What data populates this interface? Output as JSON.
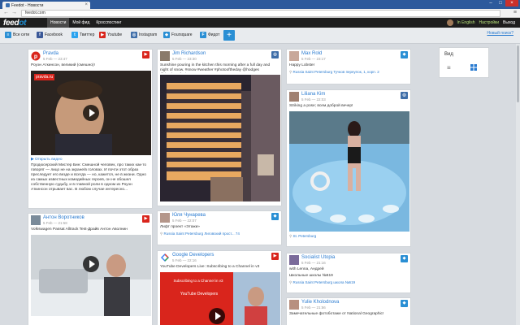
{
  "browser": {
    "tab_title": "Feedot - Новости",
    "url": "feedot.com",
    "back_icon": "arrow-left-icon",
    "forward_icon": "arrow-right-icon"
  },
  "header": {
    "logo_main": "feed",
    "logo_accent": "ot",
    "nav": [
      "Новости",
      "Мой фид",
      "Кросспостинг"
    ],
    "language": "In English",
    "settings": "Настройки",
    "logout": "Выход"
  },
  "filters": {
    "items": [
      {
        "label": "Все сети",
        "icon": "all-networks-icon",
        "color": "#2a8fd4"
      },
      {
        "label": "Facebook",
        "icon": "facebook-icon",
        "color": "#3b5998"
      },
      {
        "label": "Твиттер",
        "icon": "twitter-icon",
        "color": "#2aa3ef"
      },
      {
        "label": "Youtube",
        "icon": "youtube-icon",
        "color": "#d9251c"
      },
      {
        "label": "Instagram",
        "icon": "instagram-icon",
        "color": "#3f6ea8"
      },
      {
        "label": "Foursquare",
        "icon": "foursquare-icon",
        "color": "#2a8fd4"
      },
      {
        "label": "Фидот",
        "icon": "feedot-icon",
        "color": "#2a8fd4"
      }
    ],
    "add_label": "+",
    "new_link": "Новый поиск?"
  },
  "view_panel": {
    "title": "Вид"
  },
  "cards": {
    "pravda": {
      "name": "Pravda",
      "time": "5 Feb — 23:47",
      "text": "Роуэн Аткинсон, великий (смешно)!",
      "media_brand": "pravda.ru",
      "link": "Открыть видео",
      "body": "Продюсерский Мистер Бин: Смешной человек, про таких как-то говорят — лицо не на экране/в головах. И почти этот образ преследует его везде и всегда — но, кажется, не в жизни. Одно из самых известных комедийных героев, он не обошел собственную судьбу, и в главной роли в одном из Роуэн Аткинсон отрывает вас. В любом случае интересно..."
    },
    "voroshilov": {
      "name": "Антон Воротников",
      "time": "5 Feb — 21:58",
      "text": "Volkswagen Passat Alltrack Test-Драйв Антон Аволнин"
    },
    "jim": {
      "name": "Jim Richardson",
      "time": "5 Feb — 23:30",
      "text": "Sunshine pouring in the kitchen this morning after a full day and night of snow. #snow #weather #photooftheday @hodges @theplotsofociety"
    },
    "yulia_ch": {
      "name": "Юля Чунарева",
      "time": "5 Feb — 22:07",
      "text": "Лифт проект «Этажи»",
      "location": "Russia Saint Petersburg Лиговский прост... 74"
    },
    "google": {
      "name": "Google Developers",
      "time": "5 Feb — 22:16",
      "text": "YouTube Developers Live: Subscribing to a Channel in v3",
      "media_caption": "Subscribing to a Channel in v3",
      "media_brand": "YouTube Developers"
    },
    "max": {
      "name": "Max Rold",
      "time": "5 Feb — 23:17",
      "text": "Happy Lobster",
      "location": "Russia Saint Petersburg Тучков переулок, 1, корп. 2"
    },
    "liliana": {
      "name": "Liliana Kim",
      "time": "5 Feb — 22:03",
      "text": "Striking a pose; всем доброй вечер!",
      "location": "St. Petersburg"
    },
    "socialist": {
      "name": "Socialist Utopia",
      "time": "5 Feb — 21:16",
      "text": "with Lenna, Андрей",
      "text2": "Школьные школы №619",
      "location": "Russia Saint Petersburg школа №619"
    },
    "yulie": {
      "name": "Yulie Kholodnova",
      "time": "5 Feb — 21:56",
      "text": "Замечательные фотоботаже от National Geographic!"
    }
  }
}
